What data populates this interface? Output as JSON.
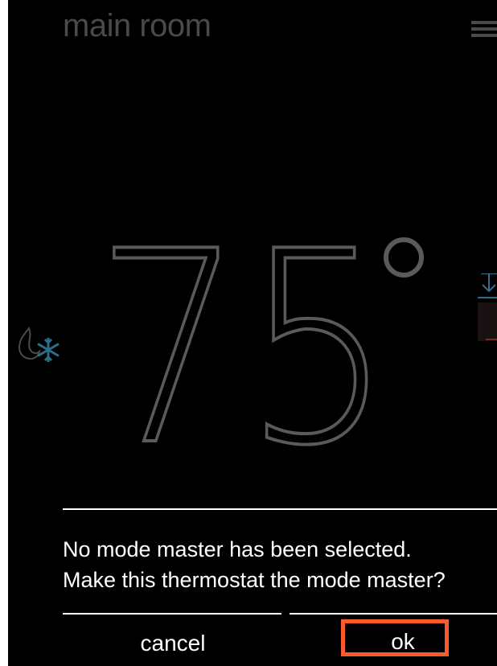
{
  "header": {
    "room_name": "main room",
    "menu_icon": "hamburger-menu-icon"
  },
  "thermostat": {
    "temperature": "75",
    "unit_symbol": "°",
    "mode_icon": "heat-cool-icon"
  },
  "dialog": {
    "message_line1": "No mode master has been selected.",
    "message_line2": "Make this thermostat the mode master?",
    "cancel_label": "cancel",
    "ok_label": "ok"
  },
  "colors": {
    "background": "#000000",
    "title_gray": "#4a4a4a",
    "temp_gray": "#5a5a5a",
    "accent_blue": "#2a6f8a",
    "highlight": "#ff5a2d"
  }
}
